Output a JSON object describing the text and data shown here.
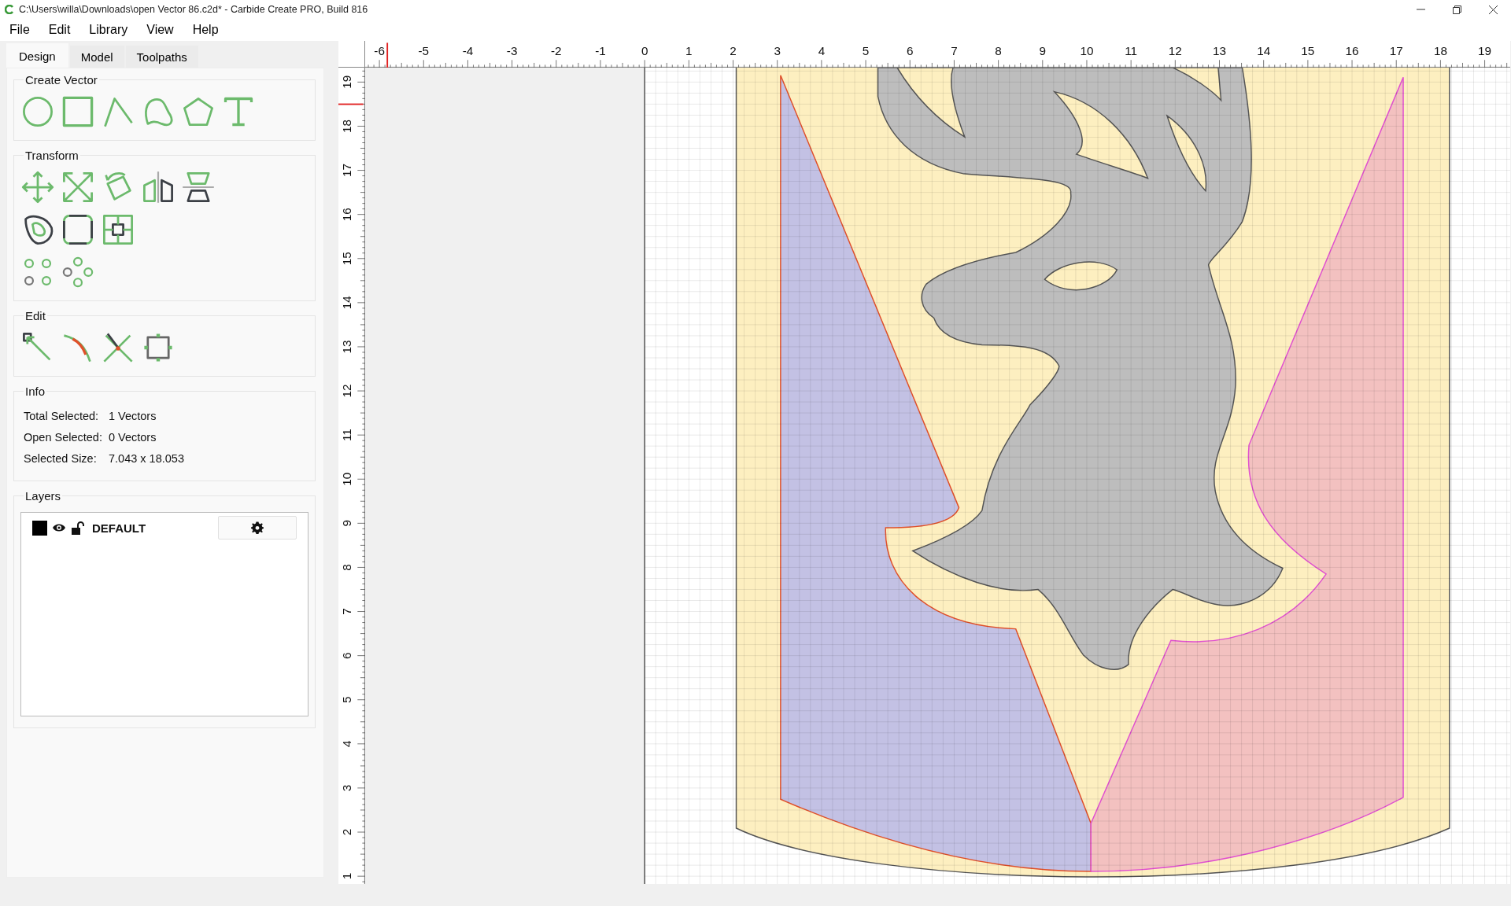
{
  "window": {
    "title": "C:\\Users\\willa\\Downloads\\open Vector 86.c2d* - Carbide Create PRO, Build 816"
  },
  "menu": [
    {
      "label": "File"
    },
    {
      "label": "Edit"
    },
    {
      "label": "Library"
    },
    {
      "label": "View"
    },
    {
      "label": "Help"
    }
  ],
  "tabs": [
    {
      "label": "Design",
      "selected": true
    },
    {
      "label": "Model",
      "selected": false
    },
    {
      "label": "Toolpaths",
      "selected": false
    }
  ],
  "sections": {
    "create_vector": {
      "title": "Create Vector"
    },
    "transform": {
      "title": "Transform"
    },
    "edit": {
      "title": "Edit"
    }
  },
  "info": {
    "title": "Info",
    "rows": [
      {
        "label": "Total Selected:",
        "value": "1 Vectors"
      },
      {
        "label": "Open Selected:",
        "value": "0 Vectors"
      },
      {
        "label": "Selected Size:",
        "value": "7.043 x 18.053"
      }
    ]
  },
  "layers": {
    "title": "Layers",
    "items": [
      {
        "name": "DEFAULT",
        "color": "#000000",
        "visible": true,
        "locked": false
      }
    ]
  },
  "rulers": {
    "x_labels": [
      "-6",
      "-5",
      "-4",
      "-3",
      "-2",
      "-1",
      "0",
      "1",
      "2",
      "3",
      "4",
      "5",
      "6",
      "7",
      "8",
      "9",
      "10",
      "11",
      "12",
      "13",
      "14",
      "15",
      "16",
      "17",
      "18",
      "19"
    ],
    "y_labels": [
      "19",
      "18",
      "17",
      "16",
      "15",
      "14",
      "13",
      "12",
      "11",
      "10",
      "9",
      "8",
      "7",
      "6",
      "5",
      "4",
      "3",
      "2",
      "1"
    ]
  }
}
